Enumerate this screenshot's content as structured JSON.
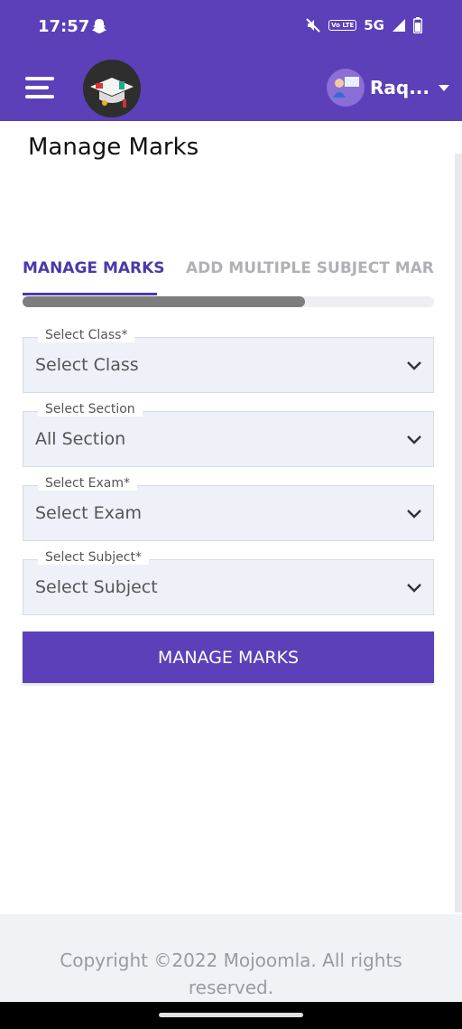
{
  "status_bar": {
    "time": "17:57",
    "network": "5G",
    "volte_label": "Vo LTE"
  },
  "header": {
    "user_name": "Raq...",
    "menu_icon": "hamburger-menu-icon",
    "logo_icon": "graduation-cap-logo"
  },
  "page": {
    "title": "Manage Marks"
  },
  "tabs": [
    {
      "label": "MANAGE MARKS",
      "active": true
    },
    {
      "label": "ADD MULTIPLE SUBJECT MARKS",
      "active": false
    }
  ],
  "form": {
    "class": {
      "label": "Select Class*",
      "value": "Select Class"
    },
    "section": {
      "label": "Select Section",
      "value": "All Section"
    },
    "exam": {
      "label": "Select Exam*",
      "value": "Select Exam"
    },
    "subject": {
      "label": "Select Subject*",
      "value": "Select Subject"
    },
    "submit_label": "MANAGE MARKS"
  },
  "footer": {
    "copyright": "Copyright ©2022 Mojoomla. All rights reserved."
  },
  "colors": {
    "brand": "#5b40b9",
    "tab_active": "#4a3aa8",
    "field_bg": "#eef1f7"
  }
}
